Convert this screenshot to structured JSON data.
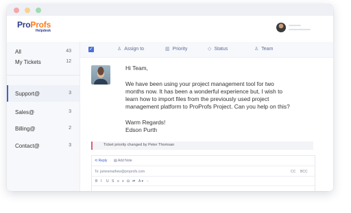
{
  "window": {
    "controls": [
      "red-dot",
      "yellow-dot",
      "green-dot"
    ]
  },
  "header": {
    "logo_pro": "Pro",
    "logo_profs": "Profs",
    "logo_sub": "Helpdesk"
  },
  "sidebar": {
    "items": [
      {
        "label": "All",
        "count": "43"
      },
      {
        "label": "My Tickets",
        "count": "12"
      },
      {
        "label": "Support@",
        "count": "3"
      },
      {
        "label": "Sales@",
        "count": "3"
      },
      {
        "label": "Billing@",
        "count": "2"
      },
      {
        "label": "Contact@",
        "count": "3"
      }
    ]
  },
  "toolbar": {
    "assign_label": "Assign to",
    "priority_label": "Priority",
    "status_label": "Status",
    "team_label": "Team"
  },
  "message": {
    "greeting": "Hi Team,",
    "body_lines": [
      "We have been using your project management tool for two",
      "months now. It has been a wonderful experience but, I wish to",
      "learn how to import files from the previously used project",
      "management platform to ProProfs Project. Can you help on this?"
    ],
    "sign_off": "Warm Regards!",
    "sender": "Edson Purth"
  },
  "activity_note": "Ticket priority changed by Peter Thomsan",
  "reply": {
    "tab_reply": "Reply",
    "tab_add_note": "Add Note",
    "to_line": "To: jamesmathew@proprofs.com",
    "cc": "CC",
    "bcc": "BCC",
    "formatting_tools": [
      "B",
      "I",
      "U",
      "S",
      "≡",
      "≡",
      "⊟",
      "⇄",
      "A ▾",
      "◌"
    ]
  },
  "colors": {
    "accent": "#4a6fd6",
    "logo_blue": "#2a3a8e",
    "logo_orange": "#ff7a1a",
    "note_marker": "#e05a73"
  }
}
